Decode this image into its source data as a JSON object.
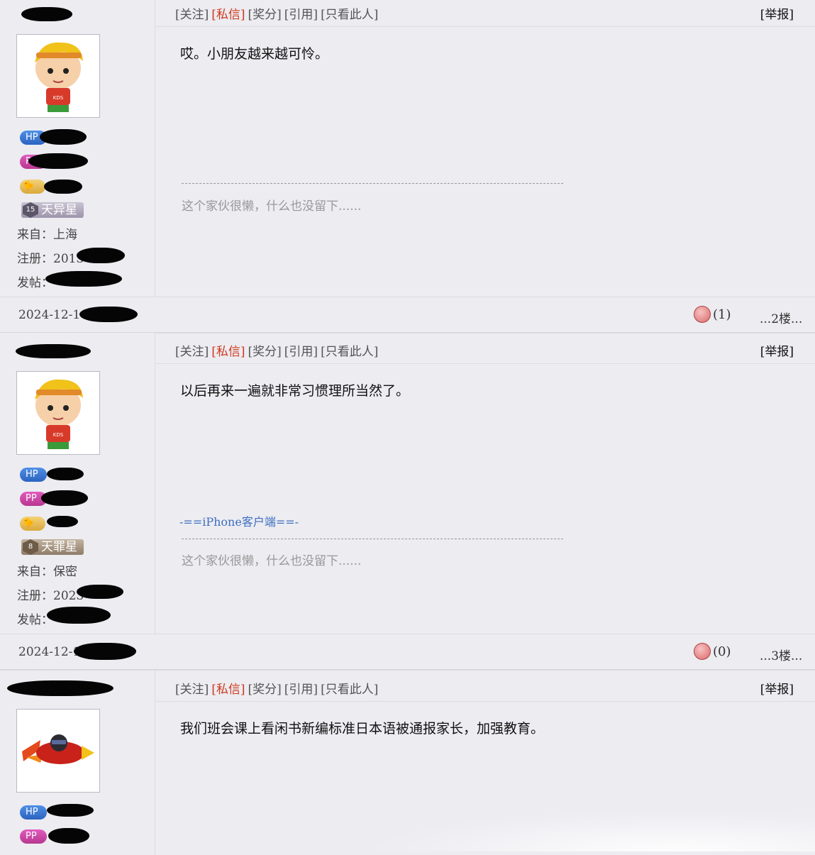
{
  "toolbar": {
    "follow": "[关注]",
    "message": "[私信]",
    "reward": "[奖分]",
    "quote": "[引用]",
    "only_this": "[只看此人]",
    "report": "[举报]"
  },
  "posts": [
    {
      "badges": {
        "hp": "HP",
        "pp": "PP"
      },
      "rank": {
        "num": "15",
        "title": "天异星"
      },
      "from_label": "来自：",
      "from": "上海",
      "reg_label": "注册：",
      "reg": "2013",
      "posts_label": "发帖：",
      "content": "哎。小朋友越来越可怜。",
      "client": "",
      "signature_divider": "--------------------------------------------------------------------------------",
      "signature": "这个家伙很懒，什么也没留下......",
      "date": "2024-12-16",
      "likes": "(1)",
      "floor": "...2楼..."
    },
    {
      "badges": {
        "hp": "HP",
        "pp": "PP"
      },
      "rank": {
        "num": "8",
        "title": "天罪星"
      },
      "from_label": "来自：",
      "from": "保密",
      "reg_label": "注册：",
      "reg": "2023",
      "posts_label": "发帖：",
      "content": "以后再来一遍就非常习惯理所当然了。",
      "client": "-==iPhone客户端==-",
      "signature_divider": "--------------------------------------------------------------------------------",
      "signature": "这个家伙很懒，什么也没留下......",
      "date": "2024-12-16",
      "likes": "(0)",
      "floor": "...3楼..."
    },
    {
      "badges": {
        "hp": "HP",
        "pp": "PP"
      },
      "content": "我们班会课上看闲书新编标准日本语被通报家长，加强教育。"
    }
  ],
  "colors": {
    "background": "#ececf1",
    "red_link": "#d0391d",
    "client_blue": "#3f6fc0",
    "hp": "#2c63c0",
    "pp": "#b8378f"
  }
}
